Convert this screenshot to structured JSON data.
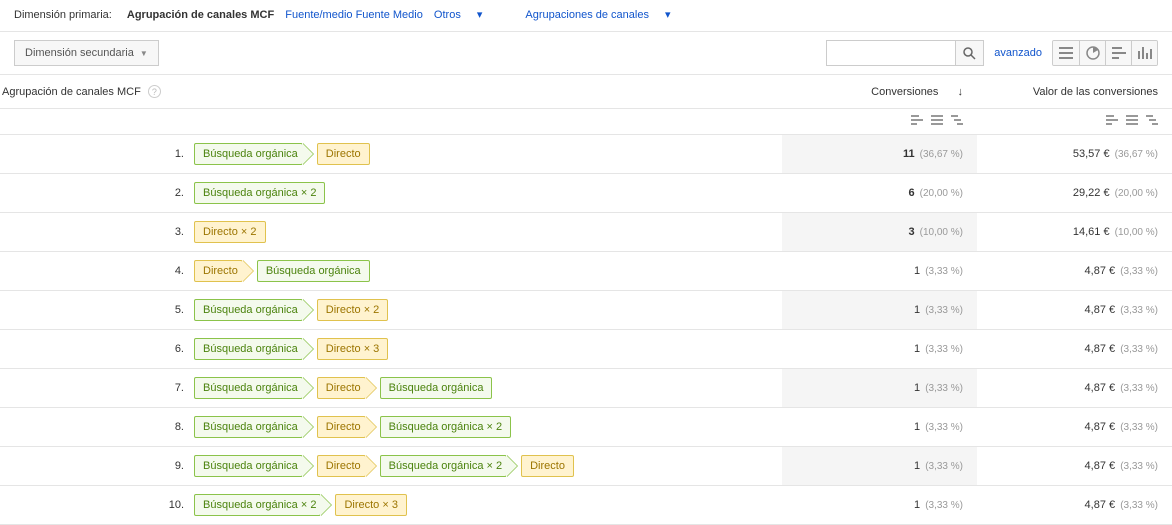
{
  "primary_dimension": {
    "label": "Dimensión primaria:",
    "active": "Agrupación de canales MCF",
    "tabs": [
      "Fuente/medio",
      "Fuente",
      "Medio",
      "Otros"
    ],
    "other_caret": "▾",
    "grouping": "Agrupaciones de canales"
  },
  "secondary_button": "Dimensión secundaria",
  "search": {
    "placeholder": ""
  },
  "advanced": "avanzado",
  "headers": {
    "dim": "Agrupación de canales MCF",
    "conv": "Conversiones",
    "val": "Valor de las conversiones"
  },
  "help_char": "?",
  "rows": [
    {
      "idx": "1.",
      "path": [
        {
          "t": "organic",
          "label": "Búsqueda orgánica",
          "arrow": true
        },
        {
          "t": "direct",
          "label": "Directo",
          "arrow": false
        }
      ],
      "conv": "11",
      "conv_pct": "(36,67 %)",
      "val": "53,57 €",
      "val_pct": "(36,67 %)"
    },
    {
      "idx": "2.",
      "path": [
        {
          "t": "organic",
          "label": "Búsqueda orgánica × 2",
          "arrow": false
        }
      ],
      "conv": "6",
      "conv_pct": "(20,00 %)",
      "val": "29,22 €",
      "val_pct": "(20,00 %)"
    },
    {
      "idx": "3.",
      "path": [
        {
          "t": "direct",
          "label": "Directo × 2",
          "arrow": false
        }
      ],
      "conv": "3",
      "conv_pct": "(10,00 %)",
      "val": "14,61 €",
      "val_pct": "(10,00 %)"
    },
    {
      "idx": "4.",
      "path": [
        {
          "t": "direct",
          "label": "Directo",
          "arrow": true
        },
        {
          "t": "organic",
          "label": "Búsqueda orgánica",
          "arrow": false
        }
      ],
      "conv": "1",
      "conv_pct": "(3,33 %)",
      "val": "4,87 €",
      "val_pct": "(3,33 %)"
    },
    {
      "idx": "5.",
      "path": [
        {
          "t": "organic",
          "label": "Búsqueda orgánica",
          "arrow": true
        },
        {
          "t": "direct",
          "label": "Directo × 2",
          "arrow": false
        }
      ],
      "conv": "1",
      "conv_pct": "(3,33 %)",
      "val": "4,87 €",
      "val_pct": "(3,33 %)"
    },
    {
      "idx": "6.",
      "path": [
        {
          "t": "organic",
          "label": "Búsqueda orgánica",
          "arrow": true
        },
        {
          "t": "direct",
          "label": "Directo × 3",
          "arrow": false
        }
      ],
      "conv": "1",
      "conv_pct": "(3,33 %)",
      "val": "4,87 €",
      "val_pct": "(3,33 %)"
    },
    {
      "idx": "7.",
      "path": [
        {
          "t": "organic",
          "label": "Búsqueda orgánica",
          "arrow": true
        },
        {
          "t": "direct",
          "label": "Directo",
          "arrow": true
        },
        {
          "t": "organic",
          "label": "Búsqueda orgánica",
          "arrow": false
        }
      ],
      "conv": "1",
      "conv_pct": "(3,33 %)",
      "val": "4,87 €",
      "val_pct": "(3,33 %)"
    },
    {
      "idx": "8.",
      "path": [
        {
          "t": "organic",
          "label": "Búsqueda orgánica",
          "arrow": true
        },
        {
          "t": "direct",
          "label": "Directo",
          "arrow": true
        },
        {
          "t": "organic",
          "label": "Búsqueda orgánica × 2",
          "arrow": false
        }
      ],
      "conv": "1",
      "conv_pct": "(3,33 %)",
      "val": "4,87 €",
      "val_pct": "(3,33 %)"
    },
    {
      "idx": "9.",
      "path": [
        {
          "t": "organic",
          "label": "Búsqueda orgánica",
          "arrow": true
        },
        {
          "t": "direct",
          "label": "Directo",
          "arrow": true
        },
        {
          "t": "organic",
          "label": "Búsqueda orgánica × 2",
          "arrow": true
        },
        {
          "t": "direct",
          "label": "Directo",
          "arrow": false
        }
      ],
      "conv": "1",
      "conv_pct": "(3,33 %)",
      "val": "4,87 €",
      "val_pct": "(3,33 %)"
    },
    {
      "idx": "10.",
      "path": [
        {
          "t": "organic",
          "label": "Búsqueda orgánica × 2",
          "arrow": true
        },
        {
          "t": "direct",
          "label": "Directo × 3",
          "arrow": false
        }
      ],
      "conv": "1",
      "conv_pct": "(3,33 %)",
      "val": "4,87 €",
      "val_pct": "(3,33 %)"
    }
  ]
}
